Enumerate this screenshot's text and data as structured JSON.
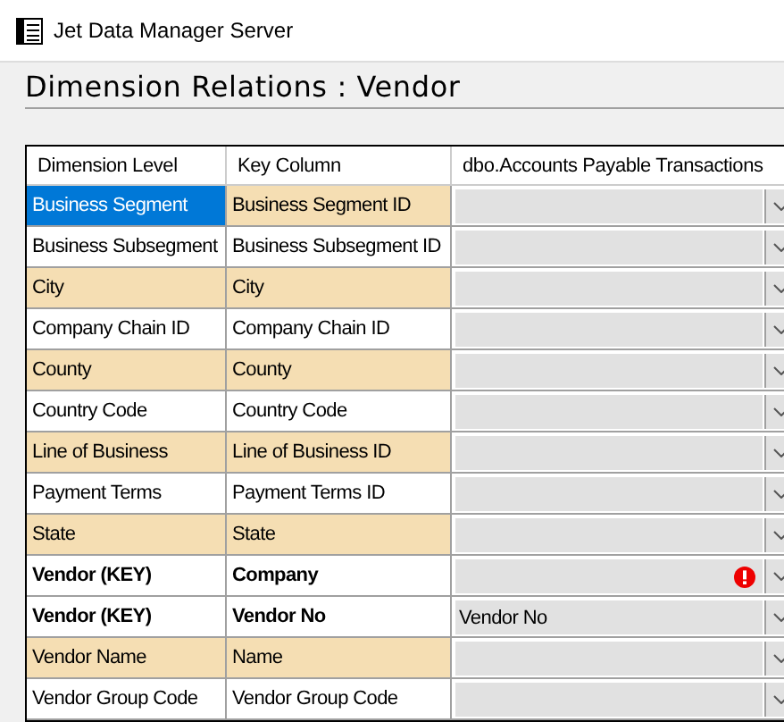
{
  "window": {
    "title": "Jet Data Manager Server"
  },
  "heading": "Dimension Relations : Vendor",
  "table": {
    "columns": [
      "Dimension Level",
      "Key Column",
      "dbo.Accounts Payable Transactions"
    ],
    "rows": [
      {
        "level": "Business Segment",
        "key": "Business Segment ID",
        "highlighted": true,
        "selected": true,
        "bold": false,
        "error": false
      },
      {
        "level": "Business Subsegment",
        "key": "Business Subsegment ID",
        "highlighted": false,
        "selected": false,
        "bold": false,
        "error": false
      },
      {
        "level": "City",
        "key": "City",
        "highlighted": true,
        "selected": false,
        "bold": false,
        "error": false
      },
      {
        "level": "Company Chain ID",
        "key": "Company Chain ID",
        "highlighted": false,
        "selected": false,
        "bold": false,
        "error": false
      },
      {
        "level": "County",
        "key": "County",
        "highlighted": true,
        "selected": false,
        "bold": false,
        "error": false
      },
      {
        "level": "Country Code",
        "key": "Country Code",
        "highlighted": false,
        "selected": false,
        "bold": false,
        "error": false
      },
      {
        "level": "Line of Business",
        "key": "Line of Business ID",
        "highlighted": true,
        "selected": false,
        "bold": false,
        "error": false
      },
      {
        "level": "Payment Terms",
        "key": "Payment Terms ID",
        "highlighted": false,
        "selected": false,
        "bold": false,
        "error": false
      },
      {
        "level": "State",
        "key": "State",
        "highlighted": true,
        "selected": false,
        "bold": false,
        "error": false
      },
      {
        "level": "Vendor (KEY)",
        "key": "Company",
        "highlighted": false,
        "selected": false,
        "bold": true,
        "error": true
      },
      {
        "level": "Vendor (KEY)",
        "key": "Vendor No",
        "value": "Vendor No",
        "highlighted": false,
        "selected": false,
        "bold": true,
        "error": false
      },
      {
        "level": "Vendor Name",
        "key": "Name",
        "highlighted": true,
        "selected": false,
        "bold": false,
        "error": false
      },
      {
        "level": "Vendor Group Code",
        "key": "Vendor Group Code",
        "highlighted": false,
        "selected": false,
        "bold": false,
        "error": false
      }
    ]
  }
}
